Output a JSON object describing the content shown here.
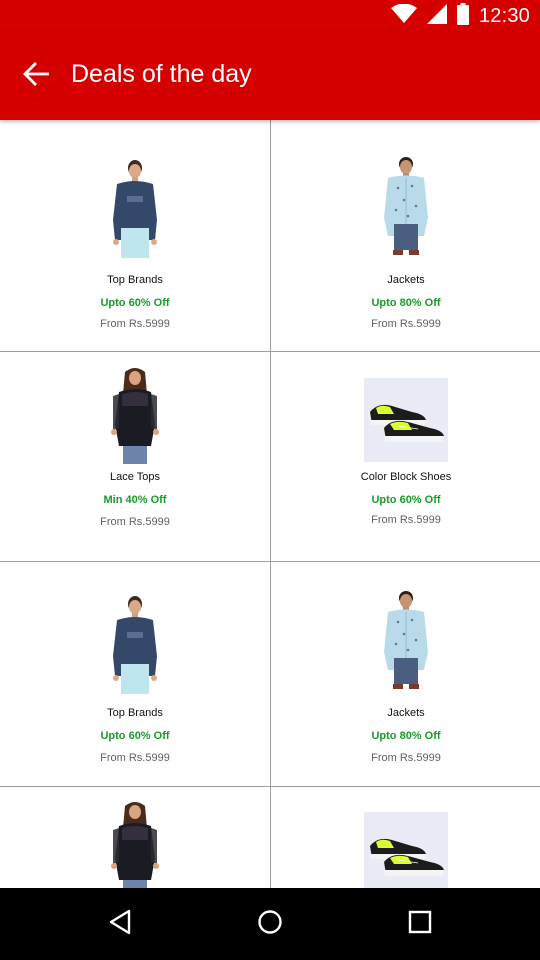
{
  "status_bar": {
    "time": "12:30"
  },
  "app_bar": {
    "title": "Deals of the day"
  },
  "deals": [
    {
      "name": "Top Brands",
      "discount": "Upto 60% Off",
      "price": "From Rs.5999",
      "image": "navy-sweatshirt-man"
    },
    {
      "name": "Jackets",
      "discount": "Upto 80% Off",
      "price": "From Rs.5999",
      "image": "printed-shirt-man"
    },
    {
      "name": "Lace Tops",
      "discount": "Min 40% Off",
      "price": "From Rs.5999",
      "image": "lace-top-woman"
    },
    {
      "name": "Color Block Shoes",
      "discount": "Upto 60% Off",
      "price": "From Rs.5999",
      "image": "neon-sneakers"
    },
    {
      "name": "Top Brands",
      "discount": "Upto 60% Off",
      "price": "From Rs.5999",
      "image": "navy-sweatshirt-man"
    },
    {
      "name": "Jackets",
      "discount": "Upto 80% Off",
      "price": "From Rs.5999",
      "image": "printed-shirt-man"
    },
    {
      "name": "",
      "discount": "",
      "price": "",
      "image": "lace-top-woman"
    },
    {
      "name": "",
      "discount": "",
      "price": "",
      "image": "neon-sneakers"
    }
  ],
  "colors": {
    "app_bar": "#d50000",
    "discount_text": "#1a9c2a",
    "price_text": "#616161"
  }
}
